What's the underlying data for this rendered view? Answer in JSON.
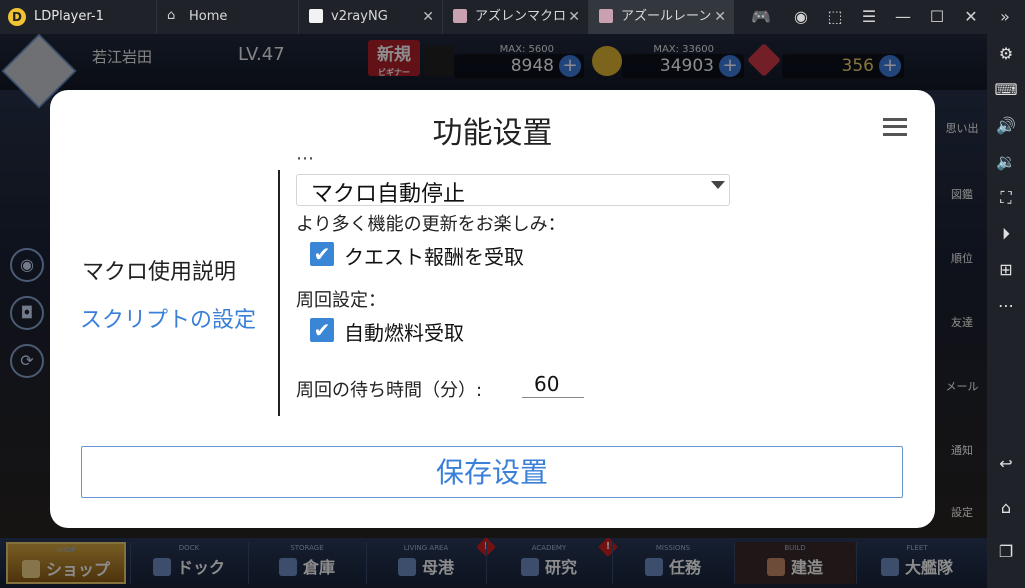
{
  "emulator": {
    "app_name": "LDPlayer-1",
    "tabs": [
      {
        "label": "Home",
        "color": "#d0d0d0"
      },
      {
        "label": "v2rayNG",
        "color": "#f2f2f2"
      },
      {
        "label": "アズレンマクロ",
        "color": "#c9a0b0"
      },
      {
        "label": "アズールレーン",
        "color": "#c9a0b0"
      }
    ],
    "close_glyph": "✕"
  },
  "game": {
    "player_name": "若江岩田",
    "level": "LV.47",
    "new_badge": "新規",
    "new_badge_sub": "ビギナー",
    "resources": [
      {
        "name": "oil",
        "max": "MAX: 5600",
        "value": "8948"
      },
      {
        "name": "coin",
        "max": "MAX: 33600",
        "value": "34903"
      },
      {
        "name": "gem",
        "max": "",
        "value": "356"
      }
    ],
    "bottom_nav": [
      {
        "label": "ショップ",
        "sub": "SHOP"
      },
      {
        "label": "ドック",
        "sub": "DOCK"
      },
      {
        "label": "倉庫",
        "sub": "STORAGE"
      },
      {
        "label": "母港",
        "sub": "LIVING AREA"
      },
      {
        "label": "研究",
        "sub": "ACADEMY"
      },
      {
        "label": "任務",
        "sub": "MISSIONS"
      },
      {
        "label": "建造",
        "sub": "BUILD"
      },
      {
        "label": "大艦隊",
        "sub": "FLEET"
      }
    ],
    "right_menu": [
      "思い出",
      "図鑑",
      "順位",
      "友達",
      "メール",
      "通知",
      "設定"
    ]
  },
  "dialog": {
    "title": "功能设置",
    "nav": {
      "usage": "マクロ使用説明",
      "script_settings": "スクリプトの設定"
    },
    "select_value": "マクロ自動停止",
    "info_text": "より多く機能の更新をお楽しみ：",
    "check_quest": "クエスト報酬を受取",
    "section_loop": "周回設定：",
    "check_fuel": "自動燃料受取",
    "wait_label": "周回の待ち時間（分）:",
    "wait_value": "60",
    "save_button": "保存设置"
  }
}
